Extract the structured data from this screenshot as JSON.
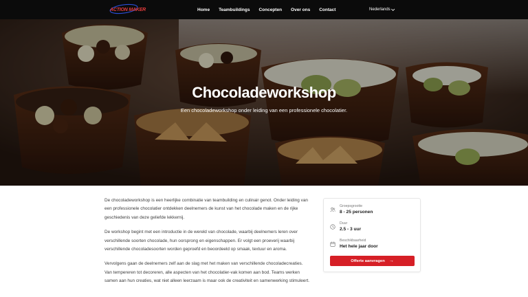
{
  "header": {
    "logo_text": "ACTION MAKER",
    "nav": [
      {
        "label": "Home"
      },
      {
        "label": "Teambuildings"
      },
      {
        "label": "Concepten"
      },
      {
        "label": "Over ons"
      },
      {
        "label": "Contact"
      }
    ],
    "language": "Nederlands"
  },
  "hero": {
    "title": "Chocoladeworkshop",
    "subtitle": "Een chocoladeworkshop onder leiding van een professionele chocolatier."
  },
  "article": {
    "paragraphs": [
      "De chocoladeworkshop is een heerlijke combinatie van teambuilding en culinair genot. Onder leiding van een professionele chocolatier ontdekken deelnemers de kunst van het chocolade maken en de rijke geschiedenis van deze geliefde lekkernij.",
      "De workshop begint met een introductie in de wereld van chocolade, waarbij deelnemers leren over verschillende soorten chocolade, hun oorsprong en eigenschappen. Er volgt een proeverij waarbij verschillende chocoladesoorten worden geproefd en beoordeeld op smaak, textuur en aroma.",
      "Vervolgens gaan de deelnemers zelf aan de slag met het maken van verschillende chocoladecreaties. Van tempereren tot decoreren, alle aspecten van het chocolatier-vak komen aan bod. Teams werken samen aan hun creaties, wat niet alleen leerzaam is maar ook de creativiteit en samenwerking stimuleert."
    ]
  },
  "info_card": {
    "items": [
      {
        "label": "Groepsgrootte",
        "value": "8 - 25 personen",
        "icon": "group-icon"
      },
      {
        "label": "Duur",
        "value": "2.5 - 3 uur",
        "icon": "clock-icon"
      },
      {
        "label": "Beschikbaarheid",
        "value": "Het hele jaar door",
        "icon": "calendar-icon"
      }
    ],
    "cta_label": "Offerte aanvragen"
  },
  "colors": {
    "nav_bg": "#0b0b0b",
    "accent": "#d61f26",
    "logo": "#e23b3b"
  }
}
